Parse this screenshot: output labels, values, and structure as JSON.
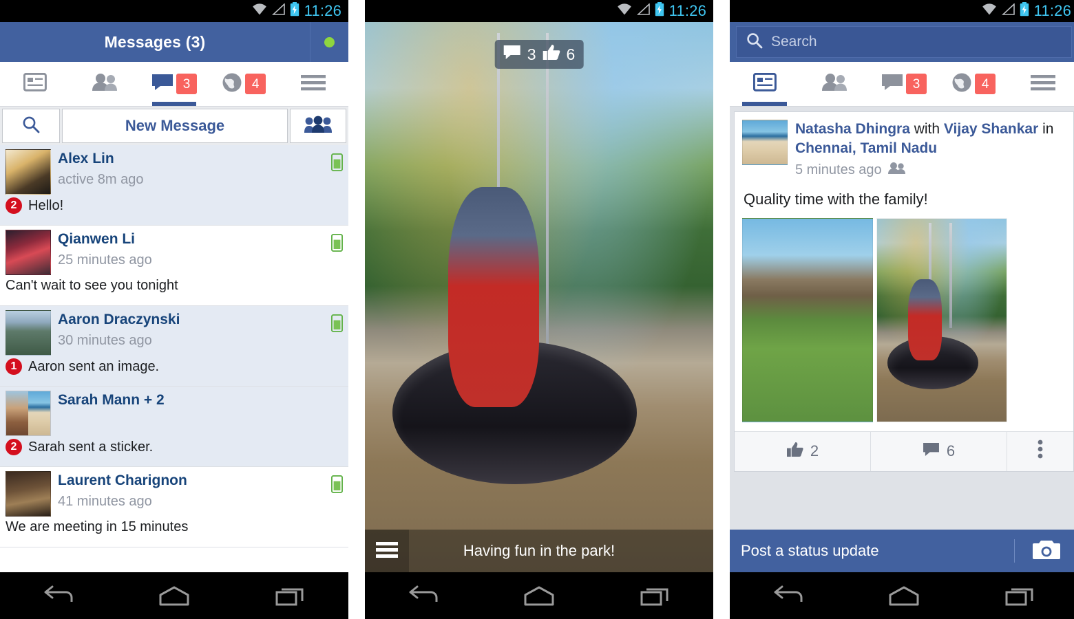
{
  "status_bar": {
    "time": "11:26",
    "icons": [
      "wifi-icon",
      "signal-icon",
      "battery-charging-icon"
    ]
  },
  "colors": {
    "fb_blue": "#42619f",
    "fb_link_blue": "#3b5998",
    "badge_red": "#f8635e",
    "unread_badge_red": "#d40f1e",
    "unread_row": "#e4eaf3",
    "presence_green": "#8ed63f",
    "status_time_blue": "#3fc5f0"
  },
  "panel_messages": {
    "header": {
      "title": "Messages (3)",
      "presence_indicator": "online-dot"
    },
    "tabs": [
      {
        "name": "news-feed",
        "icon": "news-feed-icon",
        "badge": null,
        "active": false
      },
      {
        "name": "friend-requests",
        "icon": "friends-icon",
        "badge": null,
        "active": false
      },
      {
        "name": "messages",
        "icon": "messages-icon",
        "badge": "3",
        "active": true
      },
      {
        "name": "notifications",
        "icon": "globe-icon",
        "badge": "4",
        "active": false
      },
      {
        "name": "more",
        "icon": "hamburger-icon",
        "badge": null,
        "active": false
      }
    ],
    "actions": {
      "search_icon": "search-icon",
      "new_message_label": "New Message",
      "group_icon": "new-group-icon"
    },
    "threads": [
      {
        "name": "Alex Lin",
        "time": "active 8m ago",
        "snippet": "Hello!",
        "unread_count": "2",
        "unread": true,
        "mobile_presence": true,
        "avatar_style": "img-cat"
      },
      {
        "name": "Qianwen  Li",
        "time": "25 minutes ago",
        "snippet": "Can't wait to see you tonight",
        "unread_count": null,
        "unread": false,
        "mobile_presence": true,
        "avatar_style": "img-hat"
      },
      {
        "name": "Aaron Draczynski",
        "time": "30 minutes ago",
        "snippet": "Aaron sent an image.",
        "unread_count": "1",
        "unread": true,
        "mobile_presence": true,
        "avatar_style": "img-hike"
      },
      {
        "name": "Sarah Mann + 2",
        "time": "",
        "snippet": "Sarah sent a sticker.",
        "unread_count": "2",
        "unread": true,
        "mobile_presence": false,
        "avatar_style": "dual"
      },
      {
        "name": "Laurent Charignon",
        "time": "41 minutes ago",
        "snippet": "We are meeting in 15 minutes",
        "unread_count": null,
        "unread": false,
        "mobile_presence": true,
        "avatar_style": "img-dinner"
      }
    ]
  },
  "panel_photo": {
    "badge": {
      "comment_icon": "comment-icon",
      "comment_count": "3",
      "like_icon": "thumbs-up-icon",
      "like_count": "6"
    },
    "caption": "Having fun in the park!",
    "menu_icon": "hamburger-icon"
  },
  "panel_feed": {
    "search": {
      "icon": "search-icon",
      "placeholder": "Search",
      "value": ""
    },
    "tabs": [
      {
        "name": "news-feed",
        "icon": "news-feed-icon",
        "badge": null,
        "active": true
      },
      {
        "name": "friend-requests",
        "icon": "friends-icon",
        "badge": null,
        "active": false
      },
      {
        "name": "messages",
        "icon": "messages-icon",
        "badge": "3",
        "active": false
      },
      {
        "name": "notifications",
        "icon": "globe-icon",
        "badge": "4",
        "active": false
      },
      {
        "name": "more",
        "icon": "hamburger-icon",
        "badge": null,
        "active": false
      }
    ],
    "post": {
      "author": "Natasha Dhingra",
      "with_word": "with",
      "tagged_friend": "Vijay Shankar",
      "in_word": "in",
      "location": "Chennai, Tamil Nadu",
      "timestamp": "5 minutes ago",
      "audience_icon": "friends-audience-icon",
      "message": "Quality time with the family!",
      "photos": [
        "photo-mom-and-child",
        "photo-child-on-swing"
      ],
      "actions": {
        "like_icon": "thumbs-up-icon",
        "like_count": "2",
        "comment_icon": "comment-icon",
        "comment_count": "6",
        "more_icon": "overflow-menu-icon"
      }
    },
    "composer": {
      "placeholder": "Post a status update",
      "camera_icon": "camera-icon"
    }
  },
  "nav_bar": {
    "back_icon": "back-icon",
    "home_icon": "home-icon",
    "recents_icon": "recents-icon"
  }
}
